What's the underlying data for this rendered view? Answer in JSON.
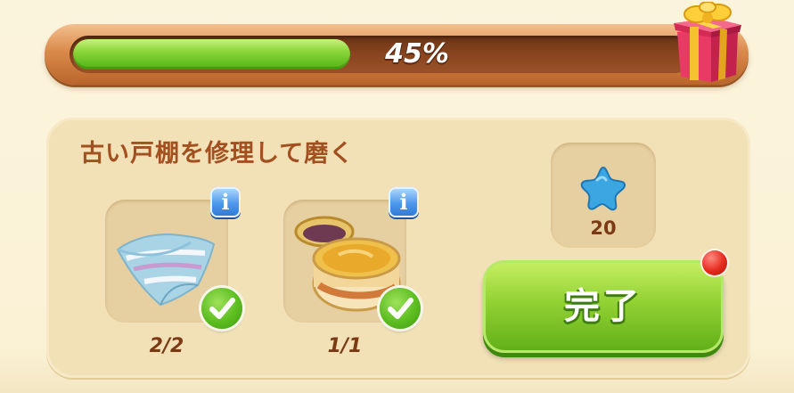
{
  "progress": {
    "value": 0.45,
    "label": "45%"
  },
  "task": {
    "title": "古い戸棚を修理して磨く",
    "items": [
      {
        "icon": "cloth-icon",
        "count": "2/2",
        "complete": true
      },
      {
        "icon": "polish-jar-icon",
        "count": "1/1",
        "complete": true
      }
    ],
    "reward": {
      "icon": "blue-star-icon",
      "value": "20"
    }
  },
  "buttons": {
    "info_label": "i",
    "complete_label": "完了"
  },
  "colors": {
    "progress_fill": "#7ccf2e",
    "button_green": "#8fcf31",
    "title_brown": "#a2501f",
    "notification_red": "#e62a1e"
  }
}
